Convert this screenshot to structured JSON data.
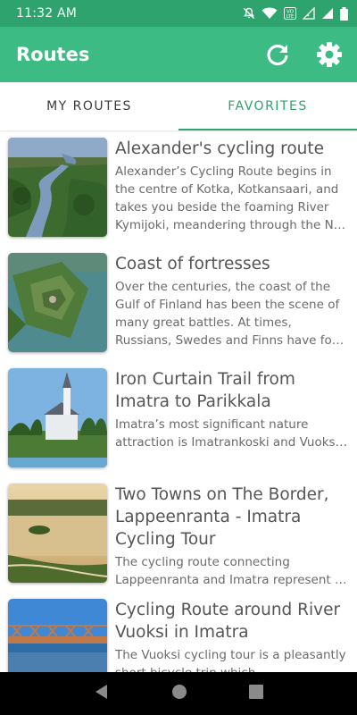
{
  "status_bar": {
    "time": "11:32 AM",
    "icons": [
      "mute-icon",
      "wifi-icon",
      "volte-icon",
      "signal-icon",
      "signal-icon",
      "battery-icon"
    ]
  },
  "app_bar": {
    "title": "Routes",
    "actions": [
      "refresh-icon",
      "settings-icon"
    ]
  },
  "tabs": [
    {
      "label": "MY ROUTES",
      "active": false
    },
    {
      "label": "FAVORITES",
      "active": true
    }
  ],
  "routes": [
    {
      "title": "Alexander's cycling route",
      "description": "Alexander’s Cycling Route begins in the centre of Kotka, Kotkansaari, and takes you beside the foaming River Kymijoki, meandering through the N…"
    },
    {
      "title": "Coast of fortresses",
      "description": "Over the centuries, the coast of the Gulf of Finland has been the scene of many great battles. At times, Russians, Swedes and Finns have fo…"
    },
    {
      "title": "Iron Curtain Trail from Imatra to Parikkala",
      "description": "Imatra’s most significant nature attraction is Imatrankoski and Vuoksi, as well as the Kruununpuisto Park w…"
    },
    {
      "title": "Two Towns on The Border, Lappeenranta - Imatra Cycling Tour",
      "description": "The cycling route connecting Lappeenranta and Imatra represent …"
    },
    {
      "title": "Cycling Route around River Vuoksi in Imatra",
      "description": "The Vuoksi cycling tour is a pleasantly short bicycle trip which"
    }
  ],
  "nav_bar": [
    "back-icon",
    "home-icon",
    "recents-icon"
  ],
  "colors": {
    "status_bar": "#2ea36e",
    "app_bar": "#3dbb84",
    "accent": "#2ea36e"
  }
}
